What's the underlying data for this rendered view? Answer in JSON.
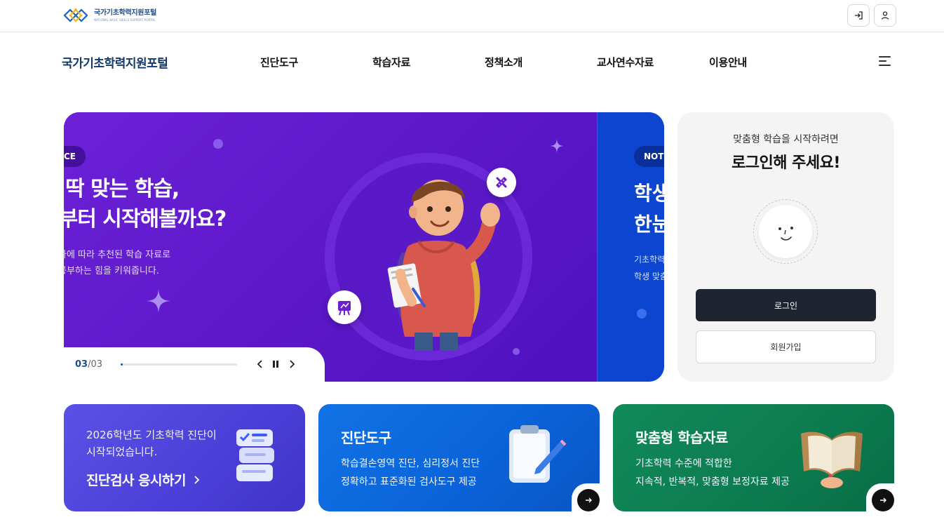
{
  "utilbar": {
    "logo_ko": "국가기초학력지원포털",
    "logo_en": "NATIONAL BASIC SKILLS SUPPORT PORTAL",
    "login_icon": "login-icon",
    "user_icon": "user-icon"
  },
  "gnb": {
    "site_title": "국가기초학력지원포털",
    "menu": [
      "진단도구",
      "학습자료",
      "정책소개",
      "교사연수자료",
      "이용안내"
    ],
    "hamburger_icon": "menu-icon"
  },
  "hero": {
    "slide_purple": {
      "badge": "CE",
      "title_line1": "게 딱 맞는 학습,",
      "title_line2": "금부터 시작해볼까요?",
      "desc_line1": "과에 따라 추천된 학습 자료로",
      "desc_line2": "공부하는 힘을 키워줍니다."
    },
    "slide_blue": {
      "badge": "NOTIC",
      "title_line1": "학생",
      "title_line2": "한눈",
      "desc_line1": "기초학력",
      "desc_line2": "학생 맞춤"
    },
    "pager_current": "03",
    "pager_sep": "/",
    "pager_total": "03",
    "progress": 0.01,
    "colors": {
      "purple": "#6c21d6",
      "blue": "#0b45d0",
      "navy": "#1d4f91"
    }
  },
  "login_panel": {
    "subtitle": "맞춤형 학습을 시작하려면",
    "title": "로그인해 주세요!",
    "login_button": "로그인",
    "join_button": "회원가입"
  },
  "cards": [
    {
      "text_line1": "2026학년도 기초학력 진단이",
      "text_line2": "시작되었습니다.",
      "cta": "진단검사 응시하기",
      "color": "#4a3fd8"
    },
    {
      "title": "진단도구",
      "desc_line1": "학습결손영역 진단, 심리정서 진단",
      "desc_line2": "정확하고 표준화된 검사도구 제공",
      "color": "#0a62d8"
    },
    {
      "title": "맞춤형 학습자료",
      "desc_line1": "기초학력 수준에 적합한",
      "desc_line2": "지속적, 반복적, 맞춤형 보정자료 제공",
      "color": "#0c7b50"
    }
  ]
}
